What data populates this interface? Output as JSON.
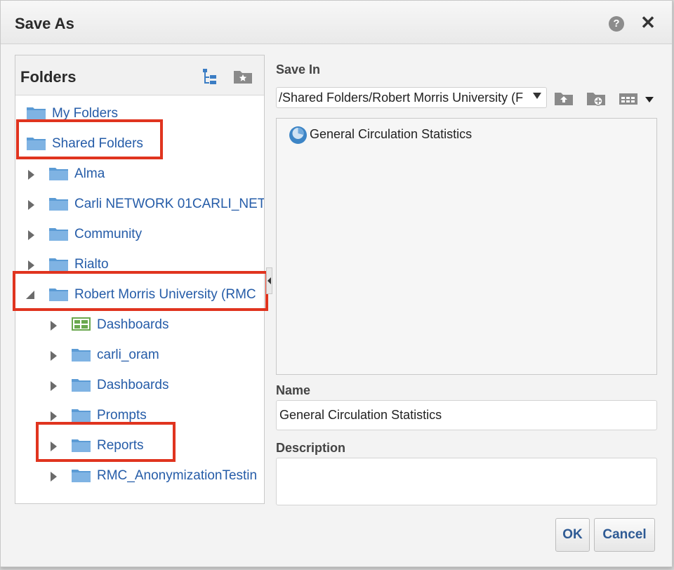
{
  "dialog": {
    "title": "Save As",
    "help_icon": "question-circle-icon",
    "close_icon": "close-x-icon"
  },
  "folders": {
    "title": "Folders",
    "tree": [
      {
        "label": "My Folders",
        "level": 0,
        "expander": "none",
        "icon": "folder-icon"
      },
      {
        "label": "Shared Folders",
        "level": 0,
        "expander": "none",
        "icon": "folder-icon"
      },
      {
        "label": "Alma",
        "level": 1,
        "expander": "collapsed",
        "icon": "folder-icon"
      },
      {
        "label": "Carli NETWORK 01CARLI_NET",
        "level": 1,
        "expander": "collapsed",
        "icon": "folder-icon"
      },
      {
        "label": "Community",
        "level": 1,
        "expander": "collapsed",
        "icon": "folder-icon"
      },
      {
        "label": "Rialto",
        "level": 1,
        "expander": "collapsed",
        "icon": "folder-icon"
      },
      {
        "label": "Robert Morris University (RMC",
        "level": 1,
        "expander": "expanded",
        "icon": "folder-icon"
      },
      {
        "label": "Dashboards",
        "level": 2,
        "expander": "collapsed",
        "icon": "dashboard-icon"
      },
      {
        "label": "carli_oram",
        "level": 2,
        "expander": "collapsed",
        "icon": "folder-icon"
      },
      {
        "label": "Dashboards",
        "level": 2,
        "expander": "collapsed",
        "icon": "folder-icon"
      },
      {
        "label": "Prompts",
        "level": 2,
        "expander": "collapsed",
        "icon": "folder-icon"
      },
      {
        "label": "Reports",
        "level": 2,
        "expander": "collapsed",
        "icon": "folder-icon"
      },
      {
        "label": "RMC_AnonymizationTestin",
        "level": 2,
        "expander": "collapsed",
        "icon": "folder-icon"
      }
    ]
  },
  "save_in": {
    "label": "Save In",
    "path": "/Shared Folders/Robert Morris University (F",
    "items": [
      {
        "label": "General Circulation Statistics",
        "icon": "analysis-icon"
      }
    ]
  },
  "name": {
    "label": "Name",
    "value": "General Circulation Statistics"
  },
  "description": {
    "label": "Description",
    "value": ""
  },
  "buttons": {
    "ok": "OK",
    "cancel": "Cancel"
  },
  "colors": {
    "link": "#255ca8",
    "highlight": "#e0341f",
    "folder": "#5b9bd5"
  }
}
